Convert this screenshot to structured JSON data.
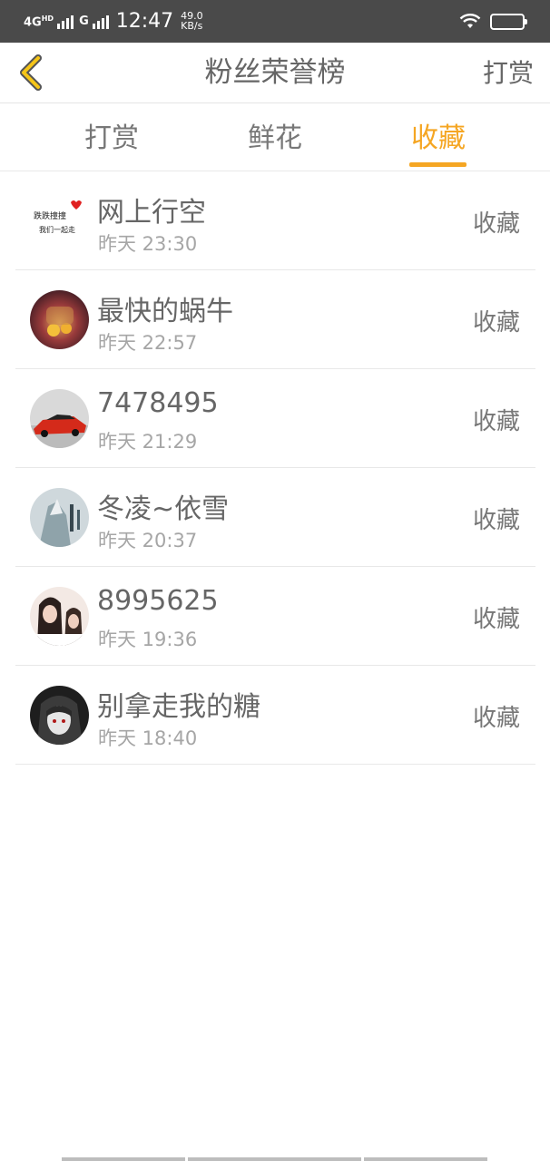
{
  "status_bar": {
    "network": "4G",
    "network_sub": "HD",
    "network2": "G",
    "time": "12:47",
    "speed_value": "49.0",
    "speed_unit": "KB/s",
    "battery": "65",
    "battery_level": 0.65
  },
  "nav": {
    "title": "粉丝荣誉榜",
    "right_label": "打赏",
    "back_icon": "chevron-left-icon",
    "accent_color": "#f5c518"
  },
  "tabs": [
    {
      "label": "打赏",
      "active": false
    },
    {
      "label": "鲜花",
      "active": false
    },
    {
      "label": "收藏",
      "active": true
    }
  ],
  "active_color": "#f5a623",
  "list": [
    {
      "name": "网上行空",
      "time": "昨天 23:30",
      "action": "收藏",
      "avatar_text_1": "跌跌撞撞",
      "avatar_text_2": "我们一起走"
    },
    {
      "name": "最快的蜗牛",
      "time": "昨天 22:57",
      "action": "收藏"
    },
    {
      "name": "7478495",
      "time": "昨天 21:29",
      "action": "收藏"
    },
    {
      "name": "冬凌~依雪",
      "time": "昨天 20:37",
      "action": "收藏"
    },
    {
      "name": "8995625",
      "time": "昨天 19:36",
      "action": "收藏"
    },
    {
      "name": "别拿走我的糖",
      "time": "昨天 18:40",
      "action": "收藏"
    }
  ]
}
